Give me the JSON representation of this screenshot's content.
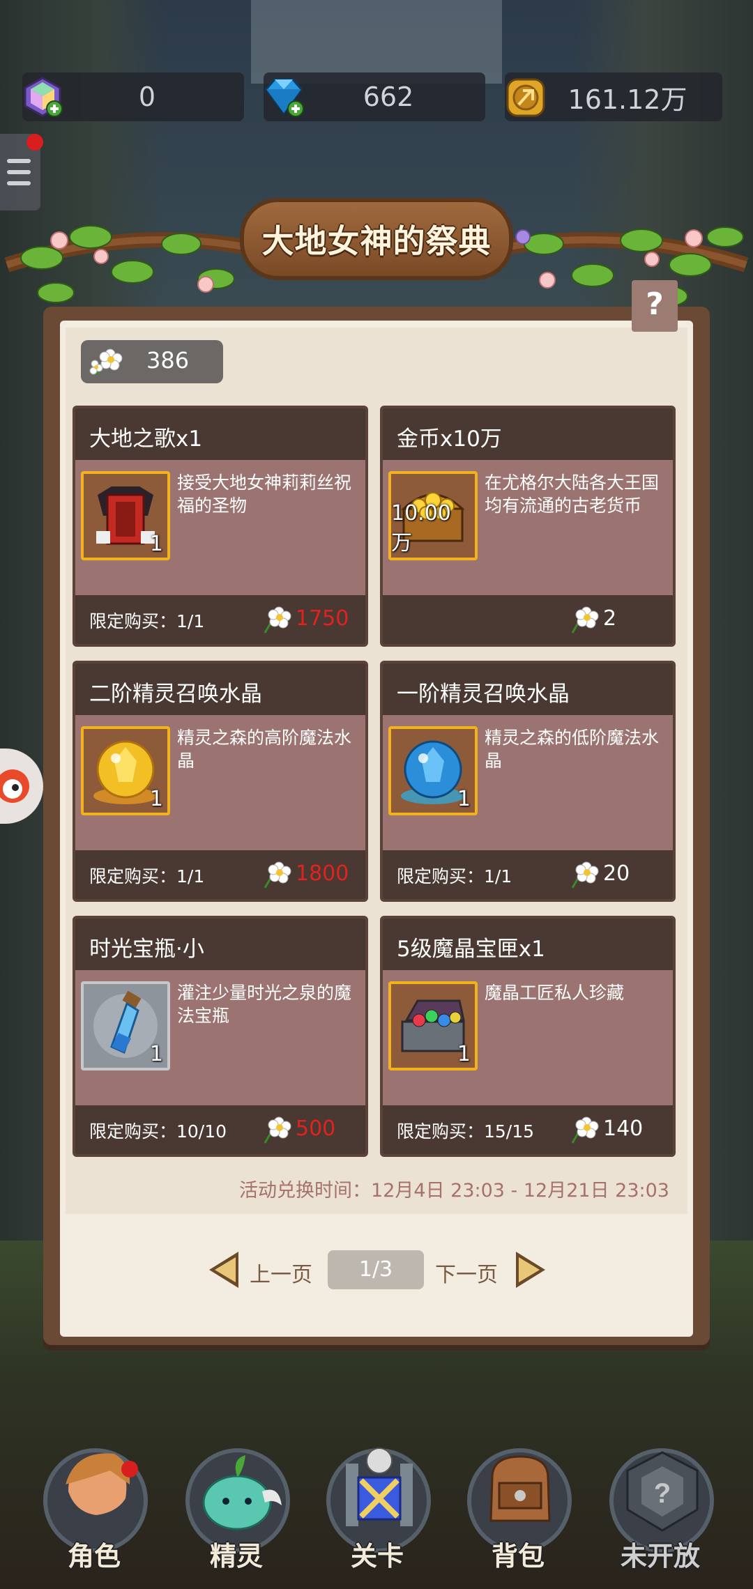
{
  "resources": [
    {
      "icon": "rainbow-gem-icon",
      "value": "0"
    },
    {
      "icon": "blue-diamond-icon",
      "value": "662"
    },
    {
      "icon": "gold-coin-icon",
      "value": "161.12万"
    }
  ],
  "event": {
    "title": "大地女神的祭典",
    "help": "?",
    "flower_count": "386",
    "time_label": "活动兑换时间：12月4日 23:03 - 12月21日 23:03"
  },
  "items": [
    {
      "name": "大地之歌x1",
      "desc": "接受大地女神莉莉丝祝福的圣物",
      "qty": "1",
      "limit": "限定购买：1/1",
      "price": "1750",
      "price_red": true,
      "icon": "red-armor-icon"
    },
    {
      "name": "金币x10万",
      "desc": "在尤格尔大陆各大王国均有流通的古老货币",
      "qty": "10.00万",
      "limit": "",
      "price": "2",
      "price_red": false,
      "icon": "gold-chest-icon"
    },
    {
      "name": "二阶精灵召唤水晶",
      "desc": "精灵之森的高阶魔法水晶",
      "qty": "1",
      "limit": "限定购买：1/1",
      "price": "1800",
      "price_red": true,
      "icon": "yellow-crystal-icon"
    },
    {
      "name": "一阶精灵召唤水晶",
      "desc": "精灵之森的低阶魔法水晶",
      "qty": "1",
      "limit": "限定购买：1/1",
      "price": "20",
      "price_red": false,
      "icon": "blue-crystal-icon"
    },
    {
      "name": "时光宝瓶·小",
      "desc": "灌注少量时光之泉的魔法宝瓶",
      "qty": "1",
      "limit": "限定购买：10/10",
      "price": "500",
      "price_red": true,
      "icon": "potion-bottle-icon"
    },
    {
      "name": "5级魔晶宝匣x1",
      "desc": "魔晶工匠私人珍藏",
      "qty": "1",
      "limit": "限定购买：15/15",
      "price": "140",
      "price_red": false,
      "icon": "gem-chest-icon"
    }
  ],
  "pager": {
    "prev": "上一页",
    "next": "下一页",
    "page": "1/3"
  },
  "nav": [
    {
      "label": "角色",
      "icon": "character-icon",
      "badge": true
    },
    {
      "label": "精灵",
      "icon": "spirit-icon",
      "badge": false
    },
    {
      "label": "关卡",
      "icon": "stage-icon",
      "badge": false
    },
    {
      "label": "背包",
      "icon": "backpack-icon",
      "badge": false
    },
    {
      "label": "未开放",
      "icon": "locked-icon",
      "badge": false
    }
  ],
  "colors": {
    "card_bg": "#9b7471",
    "card_head": "#4a3932",
    "price_red": "#e0231c",
    "panel_bg": "#f3ece0",
    "frame_wood": "#6a4a35"
  }
}
